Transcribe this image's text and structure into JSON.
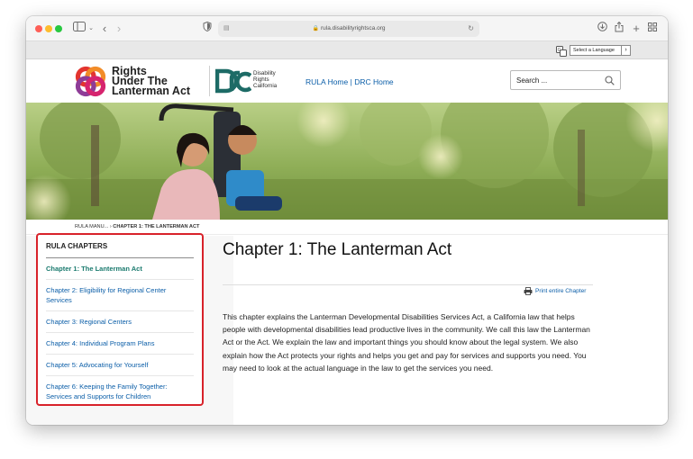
{
  "browser": {
    "url": "rula.disabilityrightsca.org",
    "lang_select_label": "Select a Language"
  },
  "header": {
    "logo_line1": "Rights",
    "logo_line2": "Under The",
    "logo_line3": "Lanterman Act",
    "drc_line1": "Disability",
    "drc_line2": "Rights",
    "drc_line3": "California",
    "link_rula_home": "RULA Home",
    "link_separator": " | ",
    "link_drc_home": "DRC Home",
    "search_placeholder": "Search ..."
  },
  "breadcrumb": {
    "parent": "RULA MANU...",
    "separator": " › ",
    "current": "CHAPTER 1: THE LANTERMAN ACT"
  },
  "sidebar": {
    "title": "RULA CHAPTERS",
    "items": [
      {
        "label": "Chapter 1: The Lanterman Act"
      },
      {
        "label": "Chapter 2: Eligibility for Regional Center Services"
      },
      {
        "label": "Chapter 3: Regional Centers"
      },
      {
        "label": "Chapter 4: Individual Program Plans"
      },
      {
        "label": "Chapter 5: Advocating for Yourself"
      },
      {
        "label": "Chapter 6: Keeping the Family Together: Services and Supports for Children"
      }
    ]
  },
  "main": {
    "title": "Chapter 1: The Lanterman Act",
    "print_label": "Print entire Chapter",
    "body": "This chapter explains the Lanterman Developmental Disabilities Services Act, a California law that helps people with developmental disabilities lead productive lives in the community. We call this law the Lanterman Act or the Act. We explain the law and important things you should know about the legal system. We also explain how the Act protects your rights and helps you get and pay for services and supports you need. You may need to look at the actual language in the law to get the services you need."
  },
  "colors": {
    "link": "#0b5ea8",
    "active_chapter": "#1a7a6e",
    "highlight_border": "#d8222a",
    "drc_teal": "#1d6b66"
  }
}
